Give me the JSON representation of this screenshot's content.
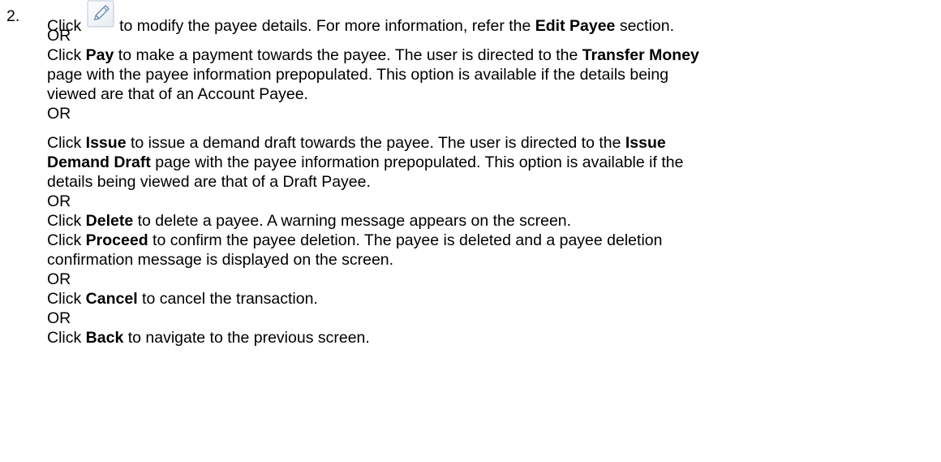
{
  "step": {
    "number": "2.",
    "icon": "edit-pencil-icon",
    "items": [
      {
        "click": "Click",
        "after_icon": "to modify the payee details. For more information, refer the",
        "bold": "Edit Payee",
        "tail": "section."
      },
      {
        "or": "OR"
      },
      {
        "line1_click": "Click",
        "line1_bold": "Pay",
        "line1_text": "to make a payment towards the payee. The user is directed to the",
        "line1_bold2": "Transfer Money",
        "line2": "page with the payee information prepopulated. This option is available if the details being",
        "line3": "viewed are that of an Account Payee."
      },
      {
        "or": "OR"
      },
      {
        "line1_click": "Click",
        "line1_bold": "Issue",
        "line1_text": "to issue a demand draft towards the payee. The user is directed to the",
        "line1_bold2": "Issue",
        "line2_bold": "Demand Draft",
        "line2_text": "page with the payee information prepopulated. This option is available if the",
        "line3": "details being viewed are that of a Draft Payee."
      },
      {
        "or": "OR"
      },
      {
        "click": "Click",
        "bold": "Delete",
        "text": "to delete a payee. A warning message appears on the screen."
      },
      {
        "click": "Click",
        "bold": "Proceed",
        "text": "to confirm the payee deletion. The payee is deleted and a payee deletion",
        "line2": "confirmation message is displayed on the screen."
      },
      {
        "or": "OR"
      },
      {
        "click": "Click",
        "bold": "Cancel",
        "text": "to cancel the transaction."
      },
      {
        "or": "OR"
      },
      {
        "click": "Click",
        "bold": "Back",
        "text": "to navigate to the previous screen."
      }
    ]
  }
}
